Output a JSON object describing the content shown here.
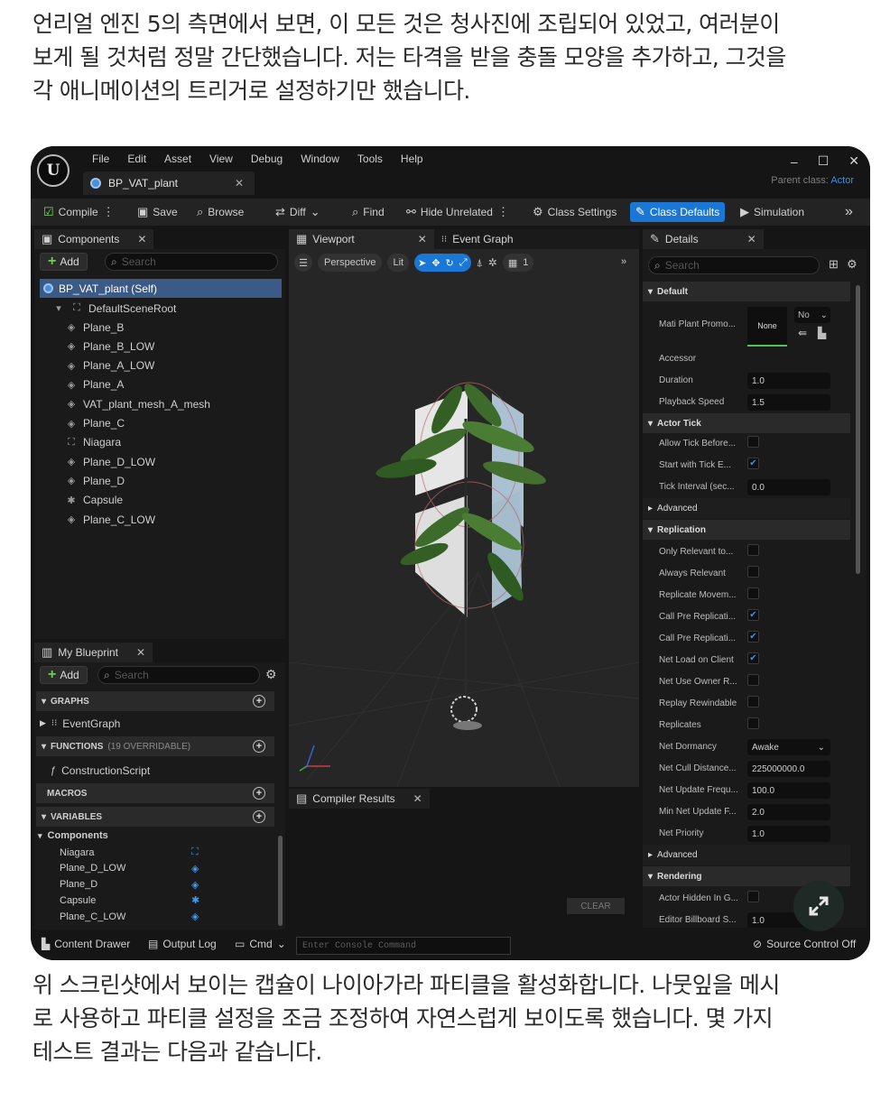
{
  "paragraph_top": {
    "lines": [
      "언리얼 엔진 5의 측면에서 보면, 이 모든 것은 청사진에 조립되어 있었고, 여러분이",
      "보게 될 것처럼 정말 간단했습니다. 저는 타격을 받을 충돌 모양을 추가하고, 그것을",
      "각 애니메이션의 트리거로 설정하기만 했습니다."
    ]
  },
  "paragraph_bottom": {
    "lines": [
      "위 스크린샷에서 보이는 캡슐이 나이아가라 파티클을 활성화합니다. 나뭇잎을 메시",
      "로 사용하고 파티클 설정을 조금 조정하여 자연스럽게 보이도록 했습니다. 몇 가지",
      "테스트 결과는 다음과 같습니다."
    ]
  },
  "editor": {
    "menu": [
      "File",
      "Edit",
      "Asset",
      "View",
      "Debug",
      "Window",
      "Tools",
      "Help"
    ],
    "tab_title": "BP_VAT_plant",
    "parent_class_label": "Parent class:",
    "parent_class_value": "Actor",
    "window_controls": [
      "–",
      "☐",
      "✕"
    ],
    "toolbar": {
      "compile": "Compile",
      "save": "Save",
      "browse": "Browse",
      "diff": "Diff",
      "find": "Find",
      "hide_unrelated": "Hide Unrelated",
      "class_settings": "Class Settings",
      "class_defaults": "Class Defaults",
      "simulation": "Simulation",
      "overflow": "»"
    },
    "components_panel": {
      "title": "Components",
      "add_label": "Add",
      "search_placeholder": "Search",
      "root": "BP_VAT_plant (Self)",
      "scene_root": "DefaultSceneRoot",
      "items": [
        {
          "label": "Plane_B",
          "icon": "mesh-icon"
        },
        {
          "label": "Plane_B_LOW",
          "icon": "mesh-icon"
        },
        {
          "label": "Plane_A_LOW",
          "icon": "mesh-icon"
        },
        {
          "label": "Plane_A",
          "icon": "mesh-icon"
        },
        {
          "label": "VAT_plant_mesh_A_mesh",
          "icon": "mesh-icon"
        },
        {
          "label": "Plane_C",
          "icon": "mesh-icon"
        },
        {
          "label": "Niagara",
          "icon": "niagara-icon"
        },
        {
          "label": "Plane_D_LOW",
          "icon": "mesh-icon"
        },
        {
          "label": "Plane_D",
          "icon": "mesh-icon"
        },
        {
          "label": "Capsule",
          "icon": "capsule-icon"
        },
        {
          "label": "Plane_C_LOW",
          "icon": "mesh-icon"
        }
      ]
    },
    "my_blueprint": {
      "title": "My Blueprint",
      "add_label": "Add",
      "search_placeholder": "Search",
      "graphs": "GRAPHS",
      "event_graph": "EventGraph",
      "functions": "FUNCTIONS",
      "functions_note": "(19 OVERRIDABLE)",
      "construction_script": "ConstructionScript",
      "macros": "MACROS",
      "variables": "VARIABLES",
      "components_group": "Components",
      "variables_list": [
        "Niagara",
        "Plane_D_LOW",
        "Plane_D",
        "Capsule",
        "Plane_C_LOW"
      ]
    },
    "viewport": {
      "tab": "Viewport",
      "event_graph_tab": "Event Graph",
      "perspective": "Perspective",
      "lit": "Lit",
      "grid_value": "1"
    },
    "compiler": {
      "tab": "Compiler Results",
      "clear": "CLEAR"
    },
    "details": {
      "title": "Details",
      "search_placeholder": "Search",
      "sections": {
        "default": "Default",
        "actor_tick": "Actor Tick",
        "advanced": "Advanced",
        "replication": "Replication",
        "advanced2": "Advanced",
        "rendering": "Rendering"
      },
      "mati_label": "Mati Plant Promo...",
      "mati_value": "None",
      "mati_dropdown": "No",
      "accessor": "Accessor",
      "duration_label": "Duration",
      "duration_value": "1.0",
      "playback_label": "Playback Speed",
      "playback_value": "1.5",
      "allow_tick": "Allow Tick Before...",
      "start_tick": "Start with Tick E...",
      "tick_interval_label": "Tick Interval (sec...",
      "tick_interval_value": "0.0",
      "only_relevant": "Only Relevant to...",
      "always_relevant": "Always Relevant",
      "replicate_movement": "Replicate Movem...",
      "call_pre_1": "Call Pre Replicati...",
      "call_pre_2": "Call Pre Replicati...",
      "net_load": "Net Load on Client",
      "net_use_owner": "Net Use Owner R...",
      "replay_rewindable": "Replay Rewindable",
      "replicates": "Replicates",
      "net_dormancy_label": "Net Dormancy",
      "net_dormancy_value": "Awake",
      "net_cull_label": "Net Cull Distance...",
      "net_cull_value": "225000000.0",
      "net_update_label": "Net Update Frequ...",
      "net_update_value": "100.0",
      "min_net_label": "Min Net Update F...",
      "min_net_value": "2.0",
      "net_priority_label": "Net Priority",
      "net_priority_value": "1.0",
      "actor_hidden": "Actor Hidden In G...",
      "editor_billboard_label": "Editor Billboard S...",
      "editor_billboard_value": "1.0"
    },
    "statusbar": {
      "content_drawer": "Content Drawer",
      "output_log": "Output Log",
      "cmd": "Cmd",
      "console_placeholder": "Enter Console Command",
      "source_control": "Source Control Off"
    }
  }
}
